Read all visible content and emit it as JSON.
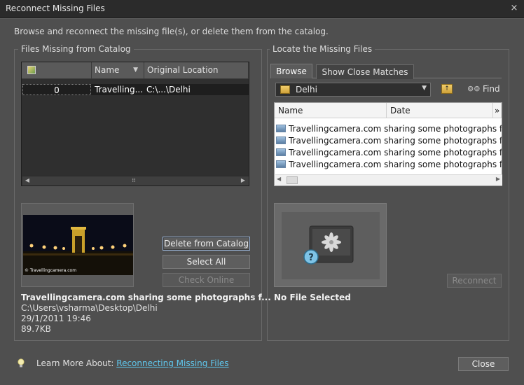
{
  "window": {
    "title": "Reconnect Missing Files",
    "close_glyph": "×"
  },
  "instructions": "Browse and reconnect the missing file(s), or delete them from the catalog.",
  "left_panel": {
    "group_title": "Files Missing from Catalog",
    "columns": [
      "Name",
      "Original Location"
    ],
    "rows": [
      {
        "index": "0",
        "name": "Travelling...",
        "location": "C:\\...\\Delhi"
      }
    ],
    "thumbnail_caption": "© Travellingcamera.com",
    "buttons": {
      "delete": "Delete from Catalog",
      "select_all": "Select All",
      "check_online": "Check Online"
    },
    "info": {
      "title": "Travellingcamera.com sharing some photographs f...",
      "path": "C:\\Users\\vsharma\\Desktop\\Delhi",
      "date": "29/1/2011 19:46",
      "size": "89.7KB"
    }
  },
  "right_panel": {
    "group_title": "Locate the Missing Files",
    "tabs": {
      "browse": "Browse",
      "close_matches": "Show Close Matches"
    },
    "folder": "Delhi",
    "find_label": "Find",
    "columns": {
      "name": "Name",
      "date": "Date",
      "more": "»"
    },
    "files": [
      "Travellingcamera.com sharing some photographs from De",
      "Travellingcamera.com sharing some photographs from De",
      "Travellingcamera.com sharing some photographs from De",
      "Travellingcamera.com sharing some photographs from De"
    ],
    "reconnect_button": "Reconnect",
    "no_file_label": "No File Selected"
  },
  "footer": {
    "learn_more": "Learn More About:",
    "link": "Reconnecting Missing Files",
    "close_button": "Close"
  },
  "colors": {
    "dialog_bg": "#4f4f4f",
    "link": "#5fc8ef",
    "selection": "#1e1e1e"
  }
}
